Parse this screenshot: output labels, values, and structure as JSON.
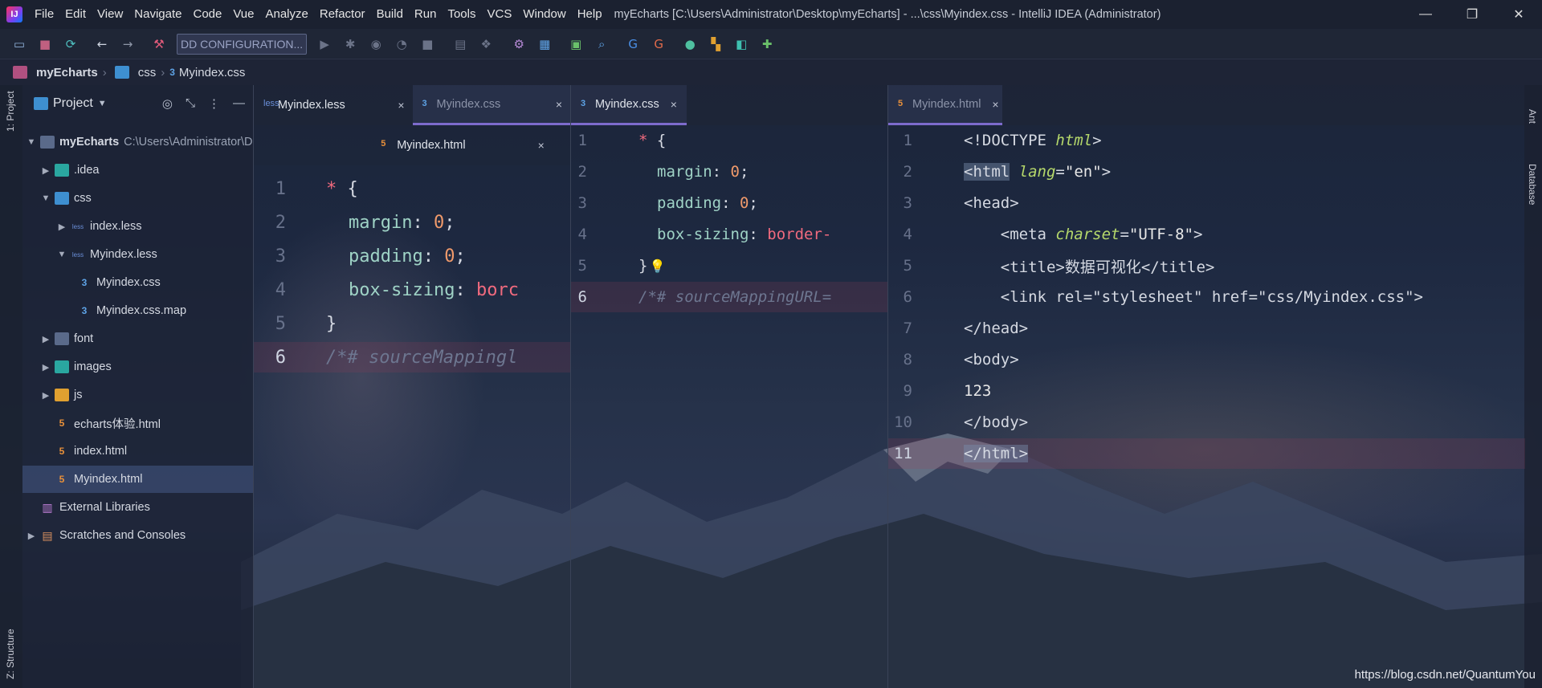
{
  "app": {
    "title": "myEcharts [C:\\Users\\Administrator\\Desktop\\myEcharts] - ...\\css\\Myindex.css - IntelliJ IDEA (Administrator)",
    "logo": "IJ",
    "menus": [
      "File",
      "Edit",
      "View",
      "Navigate",
      "Code",
      "Vue",
      "Analyze",
      "Refactor",
      "Build",
      "Run",
      "Tools",
      "VCS",
      "Window",
      "Help"
    ],
    "window_controls": {
      "minimize": "—",
      "restore": "❐",
      "close": "✕"
    }
  },
  "toolbar": {
    "run_configuration": "DD CONFIGURATION..."
  },
  "breadcrumb": {
    "project": "myEcharts",
    "folder": "css",
    "file": "Myindex.css"
  },
  "stripes": {
    "left_top": "1: Project",
    "left_bottom": "Z: Structure",
    "right_top": "Ant",
    "right_db": "Database"
  },
  "project_panel": {
    "title": "Project",
    "tree": [
      {
        "label": "myEcharts",
        "extra": "C:\\Users\\Administrator\\D",
        "type": "root"
      },
      {
        "label": ".idea",
        "type": "folder"
      },
      {
        "label": "css",
        "type": "folder"
      },
      {
        "label": "index.less",
        "type": "less"
      },
      {
        "label": "Myindex.less",
        "type": "less"
      },
      {
        "label": "Myindex.css",
        "type": "css"
      },
      {
        "label": "Myindex.css.map",
        "type": "map"
      },
      {
        "label": "font",
        "type": "folder"
      },
      {
        "label": "images",
        "type": "folder"
      },
      {
        "label": "js",
        "type": "folder"
      },
      {
        "label": "echarts体验.html",
        "type": "html"
      },
      {
        "label": "index.html",
        "type": "html"
      },
      {
        "label": "Myindex.html",
        "type": "html"
      },
      {
        "label": "External Libraries",
        "type": "lib"
      },
      {
        "label": "Scratches and Consoles",
        "type": "scratch"
      }
    ]
  },
  "pane1": {
    "tabs": [
      "Myindex.less",
      "Myindex.css",
      "Myindex.html"
    ],
    "close": "×",
    "lines": [
      {
        "n": "1",
        "sel": "*",
        "rest": " {"
      },
      {
        "n": "2",
        "prop": "margin",
        "val": "0"
      },
      {
        "n": "3",
        "prop": "padding",
        "val": "0"
      },
      {
        "n": "4",
        "prop": "box-sizing",
        "val": "borc"
      },
      {
        "n": "5",
        "rest": "}"
      },
      {
        "n": "6",
        "comment": "/*# sourceMappingl"
      }
    ]
  },
  "pane2": {
    "tabs": [
      "Myindex.css"
    ],
    "lines": [
      {
        "n": "1",
        "sel": "*",
        "rest": " {"
      },
      {
        "n": "2",
        "prop": "margin",
        "val": "0"
      },
      {
        "n": "3",
        "prop": "padding",
        "val": "0"
      },
      {
        "n": "4",
        "prop": "box-sizing",
        "val": "border-"
      },
      {
        "n": "5",
        "rest": "}"
      },
      {
        "n": "6",
        "comment": "/*# sourceMappingURL="
      }
    ]
  },
  "pane3": {
    "tabs": [
      "Myindex.html"
    ],
    "lines": [
      {
        "n": "1",
        "t1": "<!DOCTYPE ",
        "a": "html",
        "t2": ">"
      },
      {
        "n": "2",
        "open": "<html",
        "a": "lang",
        "s": "\"en\"",
        "close": ">"
      },
      {
        "n": "3",
        "txt": "<head>"
      },
      {
        "n": "4",
        "open": "    <meta ",
        "a": "charset",
        "s": "\"UTF-8\"",
        "close": ">"
      },
      {
        "n": "5",
        "txt": "    <title>数据可视化</title>"
      },
      {
        "n": "6",
        "txt": "    <link rel=\"stylesheet\" href=\"css/Myindex.css\">"
      },
      {
        "n": "7",
        "txt": "</head>"
      },
      {
        "n": "8",
        "txt": "<body>"
      },
      {
        "n": "9",
        "txt": "123"
      },
      {
        "n": "10",
        "txt": "</body>"
      },
      {
        "n": "11",
        "txt": "</html>"
      }
    ]
  },
  "watermark": "https://blog.csdn.net/QuantumYou"
}
